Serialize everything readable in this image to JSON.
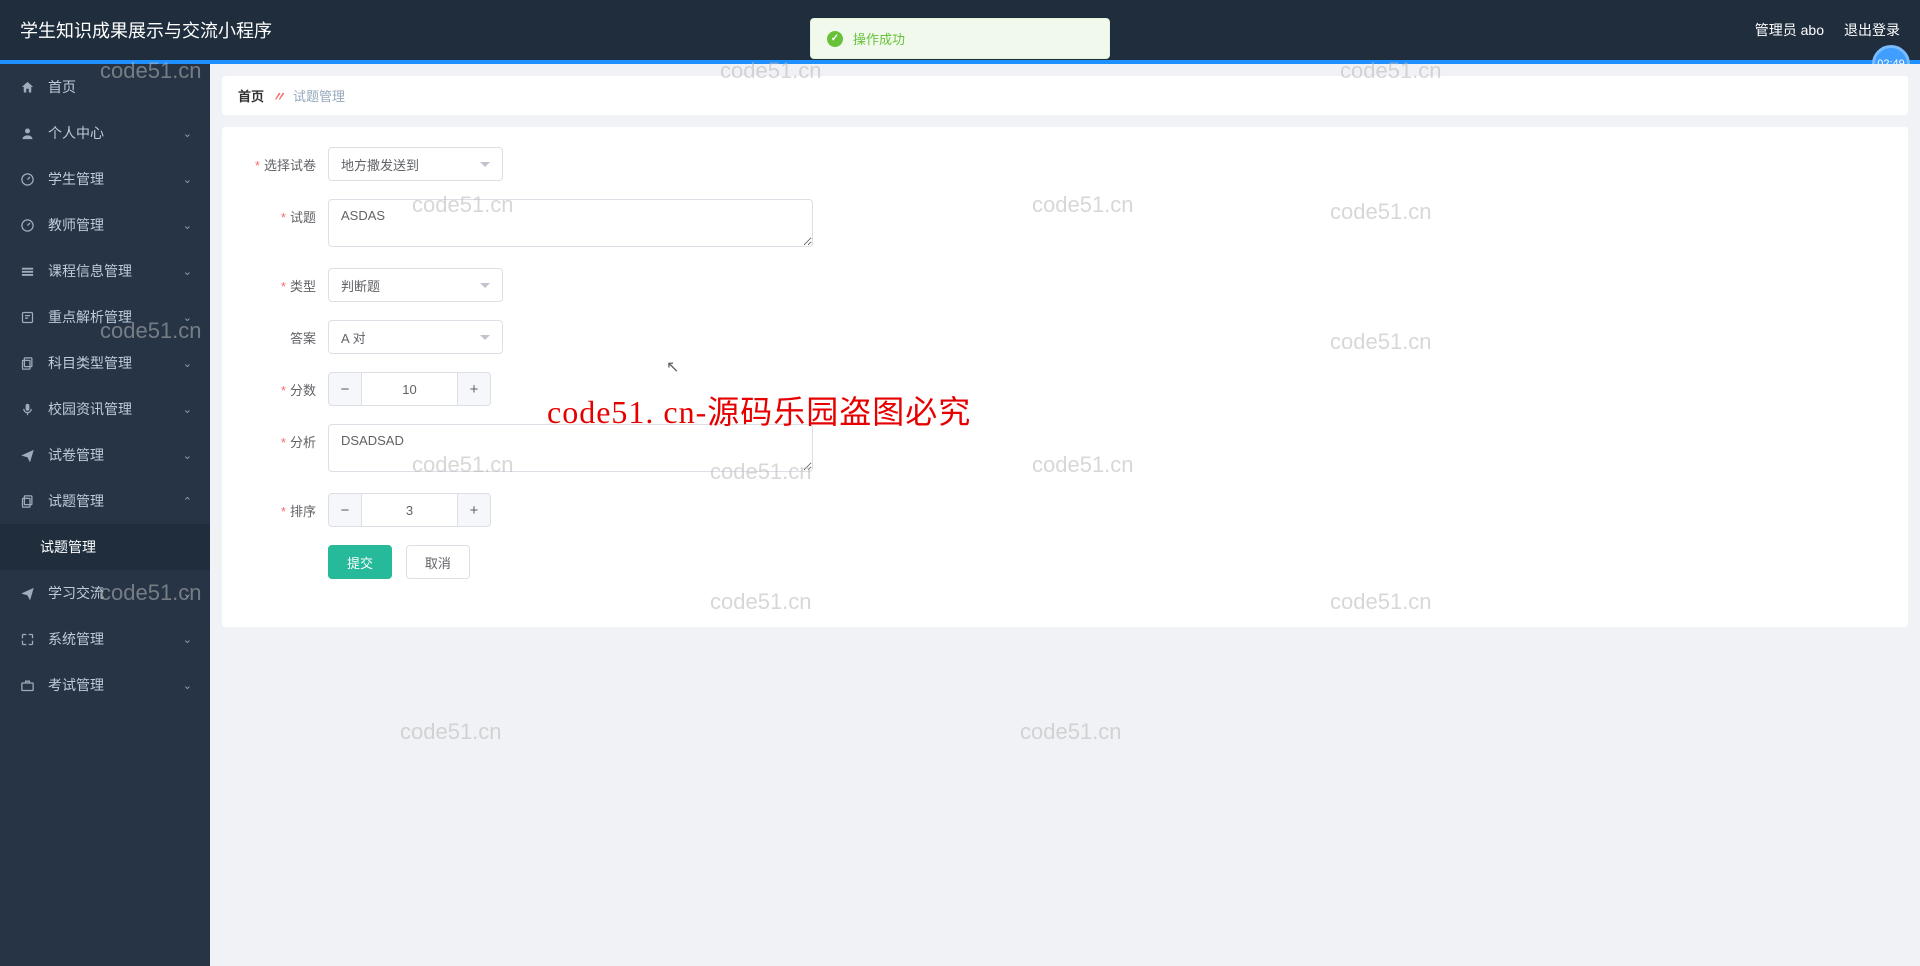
{
  "header": {
    "title": "学生知识成果展示与交流小程序",
    "user": "管理员 abo",
    "logout": "退出登录",
    "timer": "02:49"
  },
  "toast": {
    "text": "操作成功"
  },
  "sidebar": {
    "items": [
      {
        "label": "首页",
        "icon": "home",
        "arrow": false
      },
      {
        "label": "个人中心",
        "icon": "user",
        "arrow": true
      },
      {
        "label": "学生管理",
        "icon": "gauge",
        "arrow": true
      },
      {
        "label": "教师管理",
        "icon": "gauge",
        "arrow": true
      },
      {
        "label": "课程信息管理",
        "icon": "layers",
        "arrow": true
      },
      {
        "label": "重点解析管理",
        "icon": "note",
        "arrow": true
      },
      {
        "label": "科目类型管理",
        "icon": "copy",
        "arrow": true
      },
      {
        "label": "校园资讯管理",
        "icon": "mic",
        "arrow": true
      },
      {
        "label": "试卷管理",
        "icon": "paper-plane",
        "arrow": true
      },
      {
        "label": "试题管理",
        "icon": "copy",
        "arrow": true,
        "expanded": true
      },
      {
        "label": "学习交流",
        "icon": "plane",
        "arrow": true
      },
      {
        "label": "系统管理",
        "icon": "expand",
        "arrow": true
      },
      {
        "label": "考试管理",
        "icon": "briefcase",
        "arrow": true
      }
    ],
    "submenu": {
      "label": "试题管理"
    }
  },
  "breadcrumb": {
    "home": "首页",
    "sep": "〃",
    "current": "试题管理"
  },
  "form": {
    "select_paper": {
      "label": "选择试卷",
      "value": "地方撒发送到"
    },
    "question": {
      "label": "试题",
      "value": "ASDAS"
    },
    "type": {
      "label": "类型",
      "value": "判断题"
    },
    "answer": {
      "label": "答案",
      "value": "A 对"
    },
    "score": {
      "label": "分数",
      "value": "10"
    },
    "analysis": {
      "label": "分析",
      "value": "DSADSAD"
    },
    "order": {
      "label": "排序",
      "value": "3"
    },
    "submit": "提交",
    "cancel": "取消"
  },
  "watermark": {
    "text": "code51.cn",
    "red": "code51. cn-源码乐园盗图必究"
  }
}
